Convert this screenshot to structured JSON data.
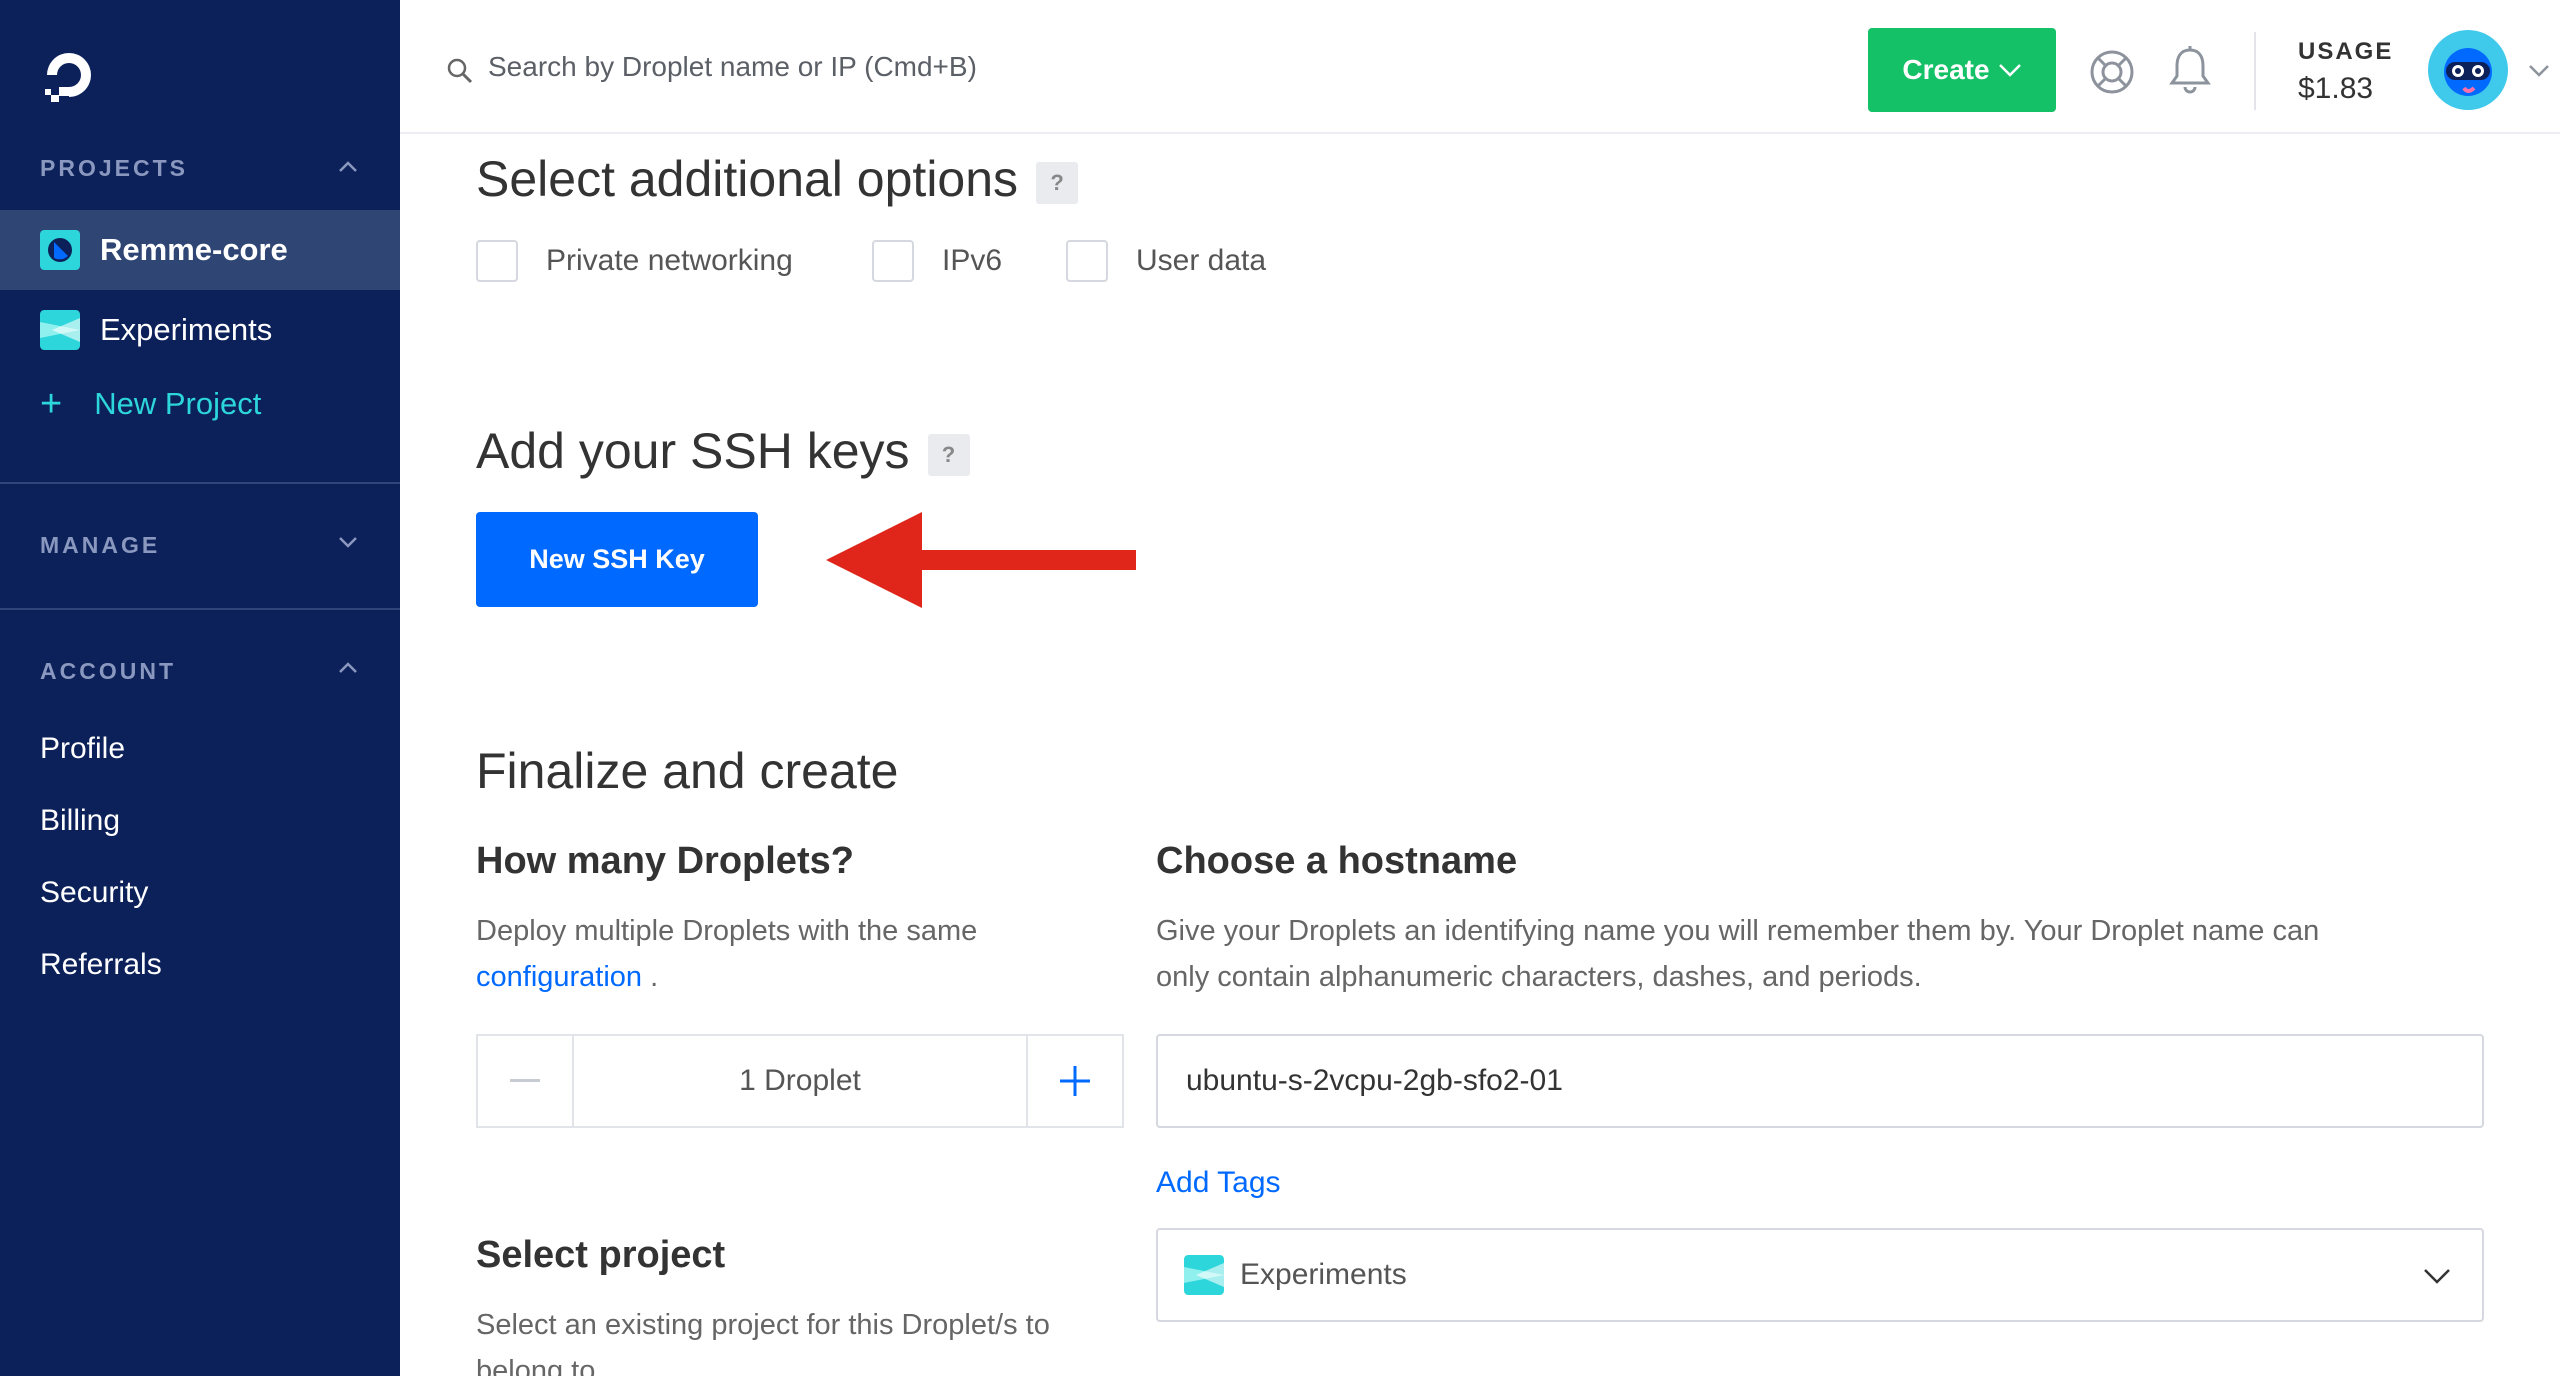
{
  "sidebar": {
    "projects_title": "PROJECTS",
    "projects": [
      {
        "label": "Remme-core"
      },
      {
        "label": "Experiments"
      }
    ],
    "new_project_label": "New Project",
    "manage_title": "MANAGE",
    "account_title": "ACCOUNT",
    "account_links": [
      "Profile",
      "Billing",
      "Security",
      "Referrals"
    ]
  },
  "topbar": {
    "search_placeholder": "Search by Droplet name or IP (Cmd+B)",
    "create_label": "Create",
    "usage_label": "USAGE",
    "usage_value": "$1.83"
  },
  "options": {
    "title": "Select additional options",
    "help": "?",
    "items": [
      "Private networking",
      "IPv6",
      "User data"
    ]
  },
  "ssh": {
    "title": "Add your SSH keys",
    "help": "?",
    "button_label": "New SSH Key"
  },
  "finalize": {
    "title": "Finalize and create",
    "droplets_title": "How many Droplets?",
    "droplets_desc": "Deploy multiple Droplets with the same",
    "droplets_link": "configuration",
    "droplets_period": ".",
    "droplet_count": "1  Droplet",
    "hostname_title": "Choose a hostname",
    "hostname_desc_1": "Give your Droplets an identifying name you will remember them by. Your Droplet name can",
    "hostname_desc_2": "only contain alphanumeric characters, dashes, and periods.",
    "hostname_value": "ubuntu-s-2vcpu-2gb-sfo2-01",
    "add_tags": "Add Tags",
    "project_title": "Select project",
    "project_desc_1": "Select an existing project for this Droplet/s to",
    "project_desc_2": "belong to.",
    "selected_project": "Experiments"
  },
  "colors": {
    "sidebar_bg": "#0c2159",
    "create_green": "#15c166",
    "primary_blue": "#0069ff",
    "arrow_red": "#e0261b"
  }
}
